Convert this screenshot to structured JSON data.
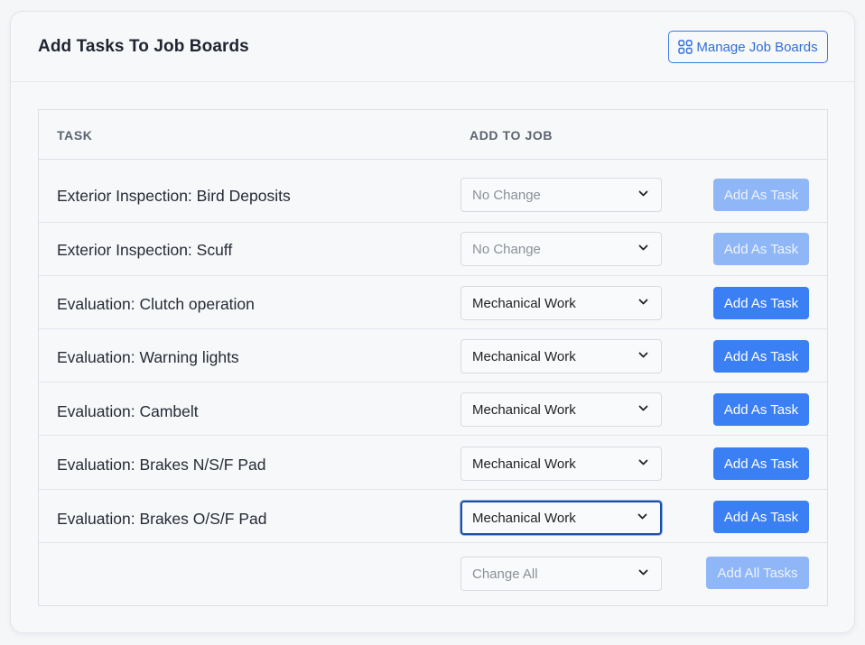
{
  "header": {
    "title": "Add Tasks To Job Boards",
    "manage_button_label": "Manage Job Boards",
    "manage_button_icon": "grid-icon"
  },
  "table": {
    "columns": [
      "TASK",
      "ADD TO JOB"
    ],
    "rows": [
      {
        "task": "Exterior Inspection: Bird Deposits",
        "job": "No Change",
        "button": "Add As Task",
        "button_disabled": true
      },
      {
        "task": "Exterior Inspection: Scuff",
        "job": "No Change",
        "button": "Add As Task",
        "button_disabled": true
      },
      {
        "task": "Evaluation: Clutch operation",
        "job": "Mechanical Work",
        "button": "Add As Task",
        "button_disabled": false
      },
      {
        "task": "Evaluation: Warning lights",
        "job": "Mechanical Work",
        "button": "Add As Task",
        "button_disabled": false
      },
      {
        "task": "Evaluation: Cambelt",
        "job": "Mechanical Work",
        "button": "Add As Task",
        "button_disabled": false
      },
      {
        "task": "Evaluation: Brakes N/S/F Pad",
        "job": "Mechanical Work",
        "button": "Add As Task",
        "button_disabled": false
      },
      {
        "task": "Evaluation: Brakes O/S/F Pad",
        "job": "Mechanical Work",
        "button": "Add As Task",
        "button_disabled": false,
        "focused": true
      }
    ],
    "footer": {
      "change_all_placeholder": "Change All",
      "add_all_label": "Add All Tasks"
    }
  },
  "colors": {
    "accent": "#3b7ff5",
    "accent_disabled": "#8fb6f7",
    "outline_button": "#3d7be0"
  }
}
